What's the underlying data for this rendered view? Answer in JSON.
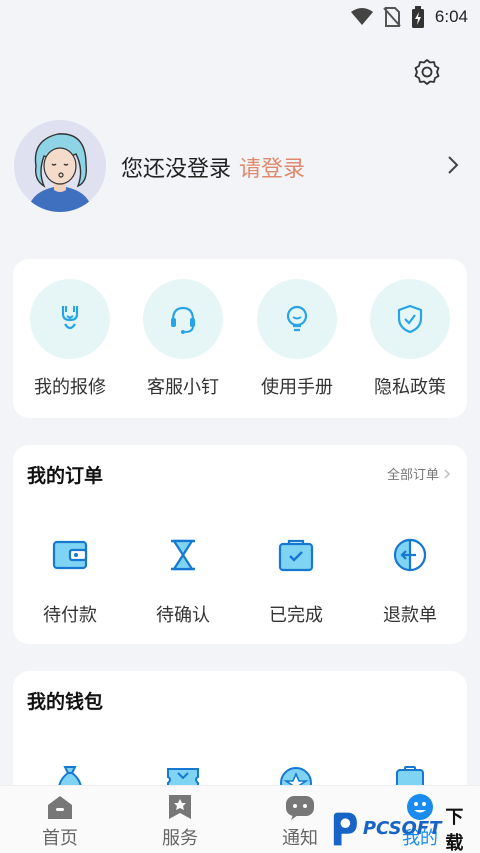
{
  "status_bar": {
    "time": "6:04"
  },
  "profile": {
    "not_logged": "您还没登录",
    "login_link": "请登录"
  },
  "quick_actions": [
    {
      "label": "我的报修",
      "icon": "repair-icon"
    },
    {
      "label": "客服小钉",
      "icon": "headset-icon"
    },
    {
      "label": "使用手册",
      "icon": "lightbulb-icon"
    },
    {
      "label": "隐私政策",
      "icon": "shield-icon"
    }
  ],
  "orders": {
    "title": "我的订单",
    "more": "全部订单",
    "items": [
      {
        "label": "待付款",
        "icon": "wallet-icon"
      },
      {
        "label": "待确认",
        "icon": "hourglass-icon"
      },
      {
        "label": "已完成",
        "icon": "check-bag-icon"
      },
      {
        "label": "退款单",
        "icon": "refund-icon"
      }
    ]
  },
  "wallet": {
    "title": "我的钱包"
  },
  "tabbar": [
    {
      "label": "首页",
      "icon": "home-icon"
    },
    {
      "label": "服务",
      "icon": "service-icon"
    },
    {
      "label": "通知",
      "icon": "chat-icon"
    },
    {
      "label": "我的",
      "icon": "user-face-icon",
      "active": true
    }
  ],
  "watermark": {
    "brand": "PCSOFT",
    "suffix": "下载"
  },
  "colors": {
    "accent": "#1a8cf0",
    "login_link": "#e0896c",
    "icon_bg": "#e6f6f6",
    "icon_blue": "#27a4e8"
  }
}
